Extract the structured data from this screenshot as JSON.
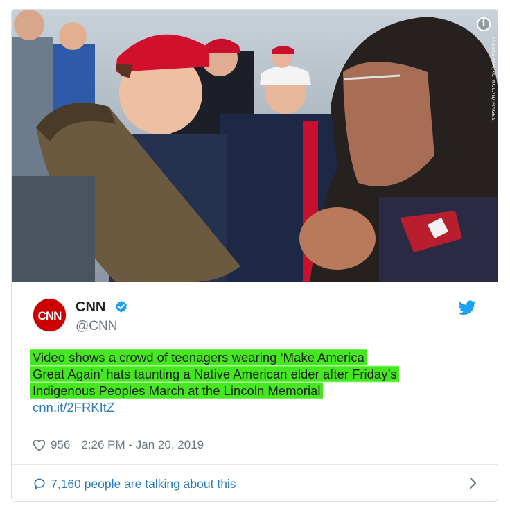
{
  "photo": {
    "info_glyph": "i",
    "credit": "INSTAGRAM/KC_NOLAN/IMAGES"
  },
  "author": {
    "logo_text": "CNN",
    "name": "CNN",
    "handle": "@CNN",
    "verified_icon": "verified-badge",
    "bird_icon": "twitter-bird"
  },
  "tweet": {
    "lines": [
      "Video shows a crowd of teenagers wearing ‘Make America",
      "Great Again’ hats taunting a Native American elder after Friday’s",
      "Indigenous Peoples March at the Lincoln Memorial"
    ],
    "link": "cnn.it/2FRKItZ",
    "highlight_color": "#45e81f"
  },
  "meta": {
    "likes": "956",
    "timestamp": "2:26 PM - Jan 20, 2019"
  },
  "footer": {
    "talking": "7,160 people are talking about this"
  },
  "colors": {
    "text": "#1c2022",
    "secondary": "#697882",
    "link": "#2b7bb9",
    "brand_red": "#cc0000",
    "twitter_blue": "#1da1f2"
  }
}
